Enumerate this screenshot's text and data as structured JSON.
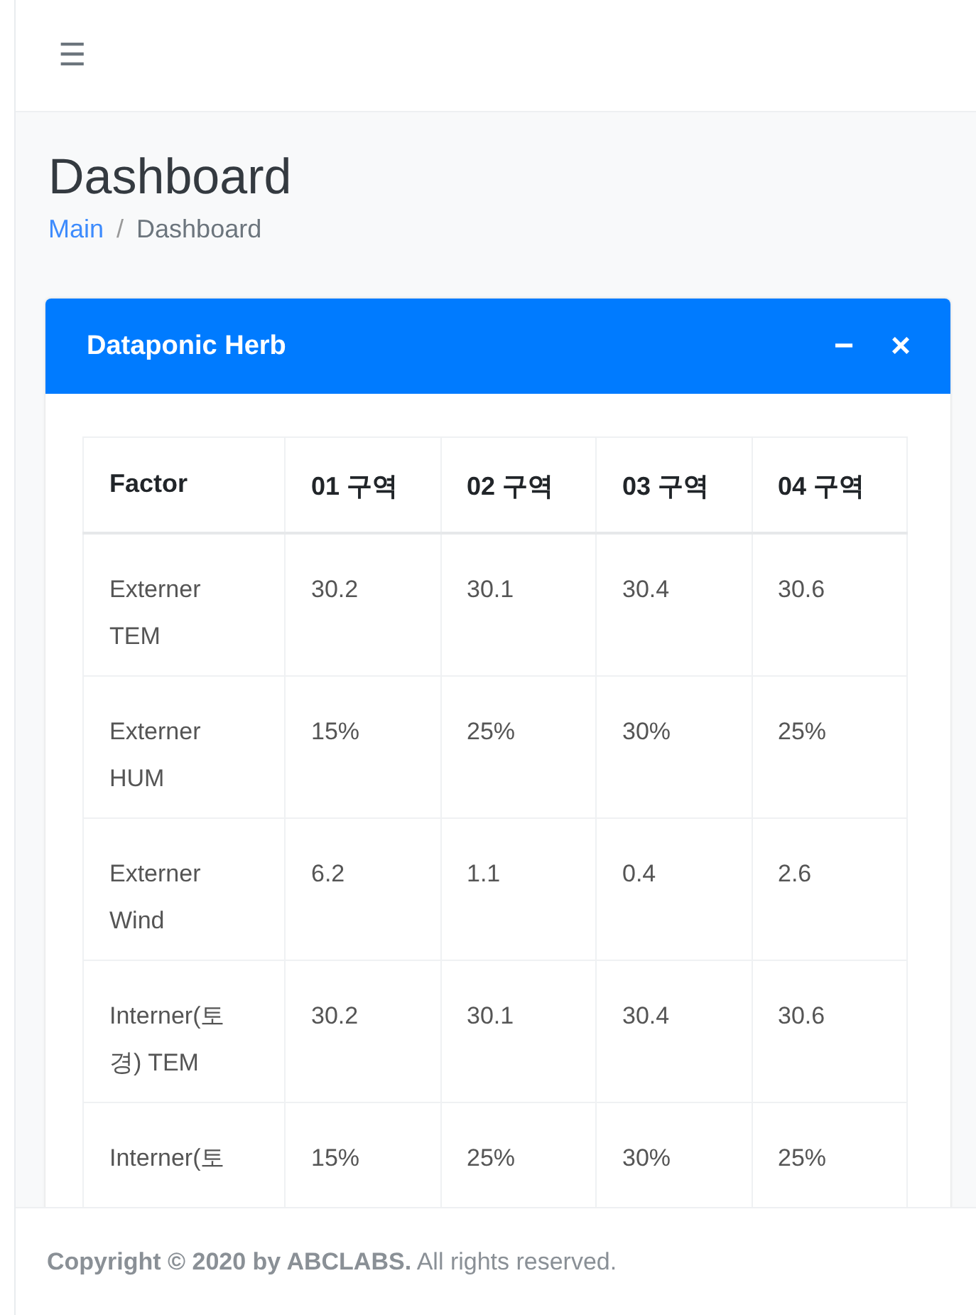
{
  "navbar": {
    "menu_icon": "☰"
  },
  "page": {
    "title": "Dashboard",
    "separator": "/",
    "breadcrumb": [
      {
        "label": "Main",
        "link": true
      },
      {
        "label": "Dashboard",
        "link": false
      }
    ]
  },
  "card": {
    "title": "Dataponic Herb",
    "collapse": "−",
    "close": "×",
    "table": {
      "columns": [
        "Factor",
        "01 구역",
        "02 구역",
        "03 구역",
        "04 구역"
      ],
      "rows": [
        [
          "Externer TEM",
          "30.2",
          "30.1",
          "30.4",
          "30.6"
        ],
        [
          "Externer HUM",
          "15%",
          "25%",
          "30%",
          "25%"
        ],
        [
          "Externer Wind",
          "6.2",
          "1.1",
          "0.4",
          "2.6"
        ],
        [
          "Interner(토경) TEM",
          "30.2",
          "30.1",
          "30.4",
          "30.6"
        ],
        [
          "Interner(토",
          "15%",
          "25%",
          "30%",
          "25%"
        ]
      ]
    }
  },
  "footer": {
    "text": "**Copyright © 2020 by ABCLABS.** All rights reserved."
  }
}
